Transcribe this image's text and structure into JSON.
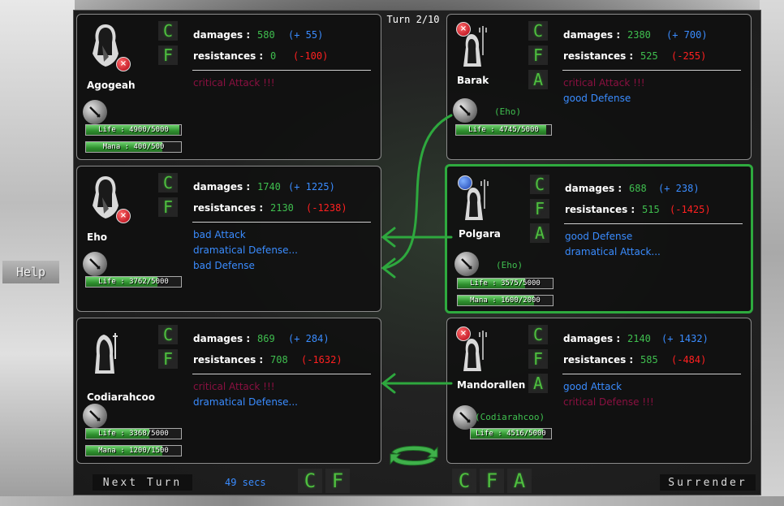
{
  "help_label": "Help",
  "turn_label": "Turn 2/10",
  "labels": {
    "damages": "damages :",
    "resistances": "resistances :"
  },
  "colors": {
    "highlight": "#2eaa3e",
    "positive": "#3a8cff",
    "negative": "#ff2020",
    "critical": "#8a1040",
    "value": "#3fbf4f"
  },
  "left": [
    {
      "name": "Agogeah",
      "actions": [
        "C",
        "F"
      ],
      "damages": "580",
      "damages_delta": "(+ 55)",
      "resistances": "0",
      "resistances_delta": "(-100)",
      "messages": [
        {
          "text": "critical Attack !!!",
          "kind": "crit"
        }
      ],
      "life_text": "Life : 4900/5000",
      "life": 0.98,
      "mana_text": "Mana : 400/500",
      "mana": 0.8,
      "status_icon": "red-x-icon"
    },
    {
      "name": "Eho",
      "actions": [
        "C",
        "F"
      ],
      "damages": "1740",
      "damages_delta": "(+ 1225)",
      "resistances": "2130",
      "resistances_delta": "(-1238)",
      "messages": [
        {
          "text": "bad Attack",
          "kind": "norm"
        },
        {
          "text": "dramatical Defense...",
          "kind": "norm"
        },
        {
          "text": "bad Defense",
          "kind": "norm"
        }
      ],
      "life_text": "Life : 3762/5000",
      "life": 0.75,
      "status_icon": "red-x-icon"
    },
    {
      "name": "Codiarahcoo",
      "actions": [
        "C",
        "F"
      ],
      "damages": "869",
      "damages_delta": "(+ 284)",
      "resistances": "708",
      "resistances_delta": "(-1632)",
      "messages": [
        {
          "text": "critical Attack !!!",
          "kind": "crit"
        },
        {
          "text": "dramatical Defense...",
          "kind": "norm"
        }
      ],
      "life_text": "Life : 3368/5000",
      "life": 0.67,
      "mana_text": "Mana : 1200/1500",
      "mana": 0.8
    }
  ],
  "right": [
    {
      "name": "Barak",
      "actions": [
        "C",
        "F",
        "A"
      ],
      "damages": "2380",
      "damages_delta": "(+ 700)",
      "resistances": "525",
      "resistances_delta": "(-255)",
      "messages": [
        {
          "text": "critical Attack !!!",
          "kind": "crit"
        },
        {
          "text": "good Defense",
          "kind": "norm"
        }
      ],
      "target": "(Eho)",
      "life_text": "Life : 4745/5000",
      "life": 0.95,
      "status_icon": "red-x-icon"
    },
    {
      "name": "Polgara",
      "actions": [
        "C",
        "F",
        "A"
      ],
      "damages": "688",
      "damages_delta": "(+ 238)",
      "resistances": "515",
      "resistances_delta": "(-1425)",
      "messages": [
        {
          "text": "good Defense",
          "kind": "norm"
        },
        {
          "text": "dramatical Attack...",
          "kind": "norm"
        }
      ],
      "target": "(Eho)",
      "life_text": "Life : 3575/5000",
      "life": 0.71,
      "mana_text": "Mana : 1600/2000",
      "mana": 0.8,
      "status_icon": "blue-orb-icon",
      "selected": true
    },
    {
      "name": "Mandorallen",
      "actions": [
        "C",
        "F",
        "A"
      ],
      "damages": "2140",
      "damages_delta": "(+ 1432)",
      "resistances": "585",
      "resistances_delta": "(-484)",
      "messages": [
        {
          "text": "good Attack",
          "kind": "norm"
        },
        {
          "text": "critical Defense !!!",
          "kind": "crit"
        }
      ],
      "target": "(Codiarahcoo)",
      "life_text": "Life : 4516/5000",
      "life": 0.9,
      "status_icon": "red-x-icon"
    }
  ],
  "bottom": {
    "next_turn": "Next Turn",
    "timer": "49 secs",
    "left_actions": [
      "C",
      "F"
    ],
    "right_actions": [
      "C",
      "F",
      "A"
    ],
    "surrender": "Surrender"
  }
}
